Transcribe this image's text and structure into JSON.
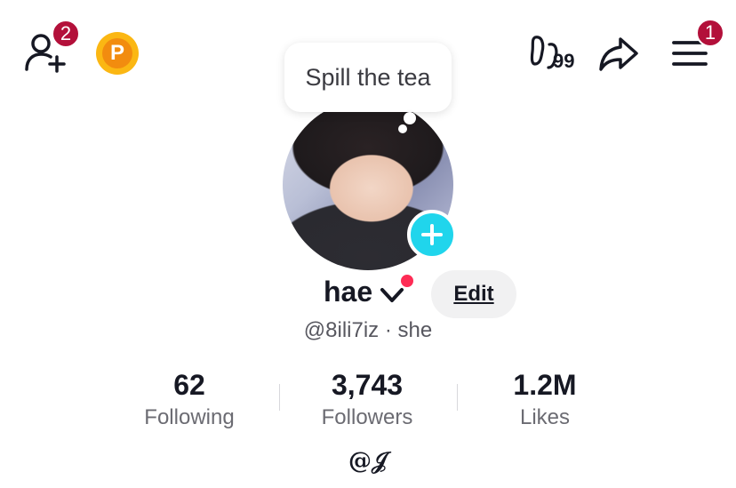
{
  "header": {
    "friend_requests_badge": "2",
    "coin_letter": "P",
    "footprints_count": "99",
    "menu_badge": "1"
  },
  "tooltip": {
    "text": "Spill the tea"
  },
  "profile": {
    "name": "hae",
    "edit_label": "Edit",
    "handle": "@8ili7iz · she",
    "bio": "@𝒥"
  },
  "stats": [
    {
      "value": "62",
      "label": "Following"
    },
    {
      "value": "3,743",
      "label": "Followers"
    },
    {
      "value": "1.2M",
      "label": "Likes"
    }
  ],
  "colors": {
    "badge": "#b3103a",
    "add_badge": "#20d5ec",
    "notification_dot": "#fe2c55",
    "coin": "#fbb713"
  }
}
